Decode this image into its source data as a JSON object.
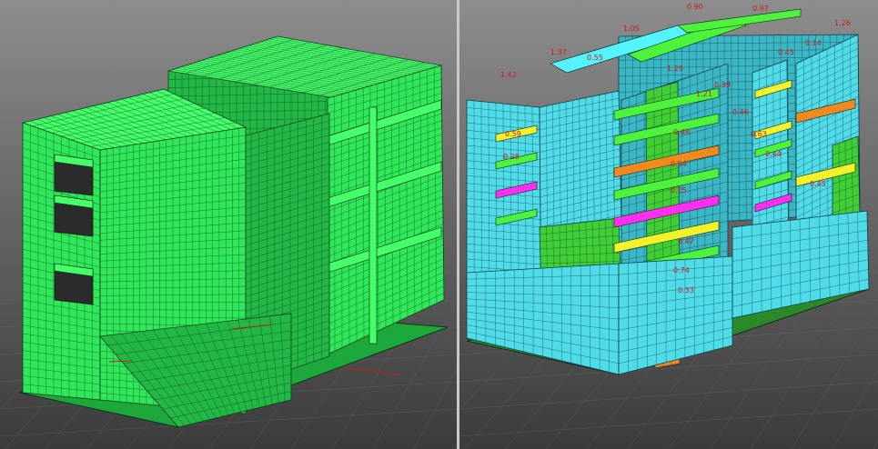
{
  "views": [
    {
      "id": "left",
      "mode": "structural-mesh",
      "colors": {
        "bg_top": "#8d8d8d",
        "bg_bottom": "#3b3b3b",
        "wall": "#2fe85a",
        "wall_dark": "#22b845",
        "wall_shade": "#1ca83a",
        "beam": "#44ff6a",
        "mesh": "#143a1c",
        "edge": "#0a2010"
      }
    },
    {
      "id": "right",
      "mode": "result-contour",
      "colors": {
        "bg_top": "#8d8d8d",
        "bg_bottom": "#3b3b3b",
        "wall": "#4fdce8",
        "wall_dark": "#3ab6c4",
        "wall_green": "#3fcf33",
        "beam_green": "#4cf23b",
        "beam_yellow": "#f2f22a",
        "beam_orange": "#f08a1e",
        "beam_magenta": "#ff2ef0",
        "beam_cyan": "#55f2ff",
        "mesh": "#123c44",
        "label": "#d01818"
      },
      "labels": [
        "1.42",
        "0.90",
        "0.97",
        "1.05",
        "1.37",
        "0.55",
        "1.29",
        "0.48",
        "1.21",
        "0.39",
        "0.46",
        "0.59",
        "0.54",
        "0.25",
        "0.47",
        "0.63",
        "0.45",
        "0.14",
        "0.74",
        "0.33",
        "0.28",
        "0.44",
        "0.45",
        "1.26"
      ]
    }
  ]
}
